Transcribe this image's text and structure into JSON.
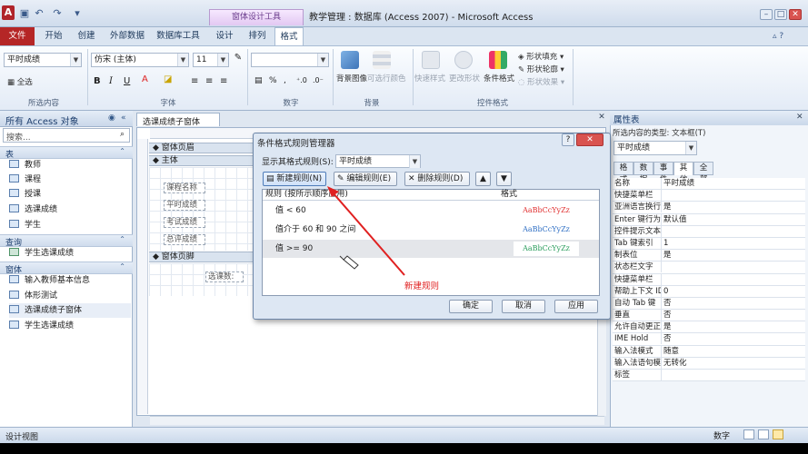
{
  "title_bar": {
    "app_icon": "A",
    "context_tab": "窗体设计工具",
    "window_title": "教学管理 : 数据库 (Access 2007) - Microsoft Access",
    "qat_icons": [
      "save-icon",
      "undo-icon",
      "redo-icon",
      "customize-icon"
    ]
  },
  "tabs": [
    "文件",
    "开始",
    "创建",
    "外部数据",
    "数据库工具",
    "设计",
    "排列",
    "格式"
  ],
  "active_tab": "格式",
  "ribbon": {
    "selection_combo": "平时成绩",
    "select_all": "全选",
    "group_selection": "所选内容",
    "font_name": "仿宋 (主体)",
    "font_size": "11",
    "group_font": "字体",
    "number_format": "",
    "group_number": "数字",
    "background_image": "背景图像",
    "alternate_color": "可选行颜色",
    "group_background": "背景",
    "quick_styles": "快速样式",
    "change_shape": "更改形状",
    "conditional_format": "条件格式",
    "shape_fill": "形状填充",
    "shape_outline": "形状轮廓",
    "shape_effects": "形状效果",
    "group_control_format": "控件格式"
  },
  "nav": {
    "header": "所有 Access 对象",
    "search_placeholder": "搜索...",
    "categories": [
      {
        "name": "表",
        "items": [
          "教师",
          "课程",
          "授课",
          "选课成绩",
          "学生"
        ]
      },
      {
        "name": "查询",
        "items": [
          "学生选课成绩"
        ]
      },
      {
        "name": "窗体",
        "items": [
          "输入教师基本信息",
          "体形测试",
          "选课成绩子窗体",
          "学生选课成绩"
        ]
      }
    ]
  },
  "document": {
    "tab": "选课成绩子窗体",
    "form_header": "窗体页眉",
    "detail": "主体",
    "form_footer": "窗体页脚",
    "field_labels": [
      "课程名称",
      "平时成绩",
      "考试成绩",
      "总评成绩"
    ],
    "footer_label": "选课数:"
  },
  "property_sheet": {
    "title": "属性表",
    "selection_type": "所选内容的类型: 文本框(T)",
    "selected_control": "平时成绩",
    "tabs": [
      "格式",
      "数据",
      "事件",
      "其他",
      "全部"
    ],
    "active_tab": "其他",
    "rows": [
      [
        "名称",
        "平时成绩"
      ],
      [
        "快捷菜单栏",
        ""
      ],
      [
        "亚洲语言换行",
        "是"
      ],
      [
        "Enter 键行为",
        "默认值"
      ],
      [
        "控件提示文本",
        ""
      ],
      [
        "Tab 键索引",
        "1"
      ],
      [
        "制表位",
        "是"
      ],
      [
        "状态栏文字",
        ""
      ],
      [
        "快捷菜单栏",
        ""
      ],
      [
        "帮助上下文 ID",
        "0"
      ],
      [
        "自动 Tab 键",
        "否"
      ],
      [
        "垂直",
        "否"
      ],
      [
        "允许自动更正",
        "是"
      ],
      [
        "IME Hold",
        "否"
      ],
      [
        "输入法模式",
        "随意"
      ],
      [
        "输入法语句模",
        "无转化"
      ],
      [
        "标签",
        ""
      ]
    ]
  },
  "dialog": {
    "title": "条件格式规则管理器",
    "show_rules_for_label": "显示其格式规则(S):",
    "show_rules_for_value": "平时成绩",
    "new_rule": "新建规则(N)",
    "edit_rule": "编辑规则(E)",
    "delete_rule": "删除规则(D)",
    "col_rule": "规则 (按所示顺序应用)",
    "col_format": "格式",
    "rules": [
      {
        "rule": "值 < 60",
        "sample": "AaBbCcYyZz",
        "color": "#e03030"
      },
      {
        "rule": "值介于 60 和 90 之间",
        "sample": "AaBbCcYyZz",
        "color": "#2f6fc4"
      },
      {
        "rule": "值 >= 90",
        "sample": "AaBbCcYyZz",
        "color": "#2a9d5c"
      }
    ],
    "ok": "确定",
    "cancel": "取消",
    "apply": "应用"
  },
  "annotation": "新建规则",
  "status": {
    "left": "设计视图",
    "right": "数字"
  }
}
